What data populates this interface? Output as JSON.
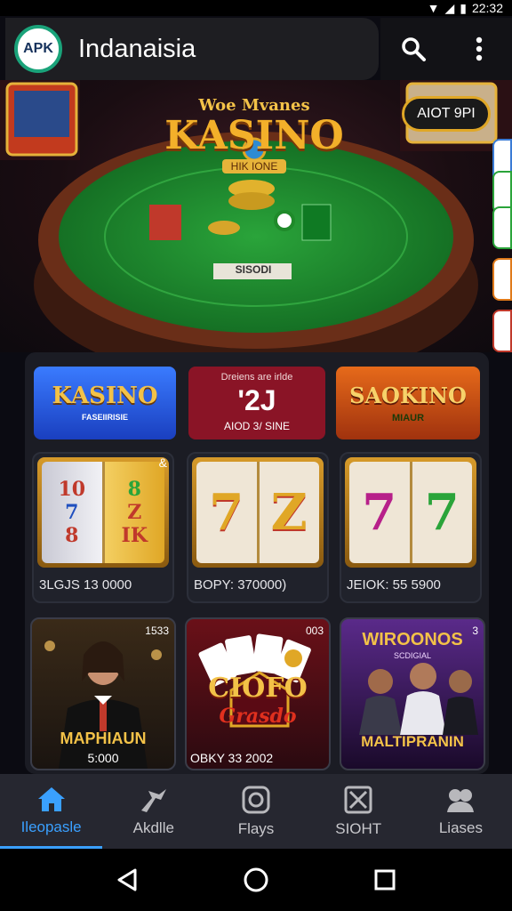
{
  "status": {
    "time": "22:32"
  },
  "app": {
    "logo_text": "APK",
    "title": "Indanaisia"
  },
  "hero": {
    "logo_top": "Woe Mvanes",
    "logo_main": "KASINO",
    "logo_sub": "HIK  IONE",
    "badge": "AIOT 9PI",
    "table_label": "SISODI"
  },
  "banners": [
    {
      "title": "KASINO",
      "subtitle": "FASEIIRISIE"
    },
    {
      "top": "Dreiens are irlde",
      "big": "'2J",
      "bottom": "AIOD 3/ SINE"
    },
    {
      "title": "SAOKINO",
      "subtitle": "MIAUR"
    }
  ],
  "slots": [
    {
      "caption": "3LGJS 13 0000",
      "reels": [
        [
          "10",
          "7",
          "8"
        ],
        [
          "8",
          "Z",
          "IK"
        ]
      ],
      "corner": "&"
    },
    {
      "caption": "BOPY: 370000)",
      "reels": [
        [
          "7"
        ],
        [
          "Z"
        ]
      ]
    },
    {
      "caption": "JEIOK: 55 5900",
      "reels": [
        [
          "7"
        ],
        [
          "7"
        ]
      ]
    }
  ],
  "games": [
    {
      "title": "MAPHIAUN",
      "footer": "5:000",
      "corner": "1533"
    },
    {
      "title": "CIOFO",
      "subtitle": "Grasdo",
      "footer": "OBKY 33 2002",
      "corner": "003"
    },
    {
      "title": "WIROONOS",
      "subtitle": "SCDIGIAL",
      "footer": "MALTIPRANIN",
      "corner": "3"
    }
  ],
  "nav": [
    {
      "label": "Ileopasle",
      "icon": "home-icon"
    },
    {
      "label": "Akdlle",
      "icon": "slots-icon"
    },
    {
      "label": "Flays",
      "icon": "chip-icon"
    },
    {
      "label": "SIOHT",
      "icon": "box-icon"
    },
    {
      "label": "Liases",
      "icon": "people-icon"
    }
  ],
  "colors": {
    "accent": "#3aa0ff",
    "felt": "#1f8a2a",
    "gold": "#e0a726"
  }
}
